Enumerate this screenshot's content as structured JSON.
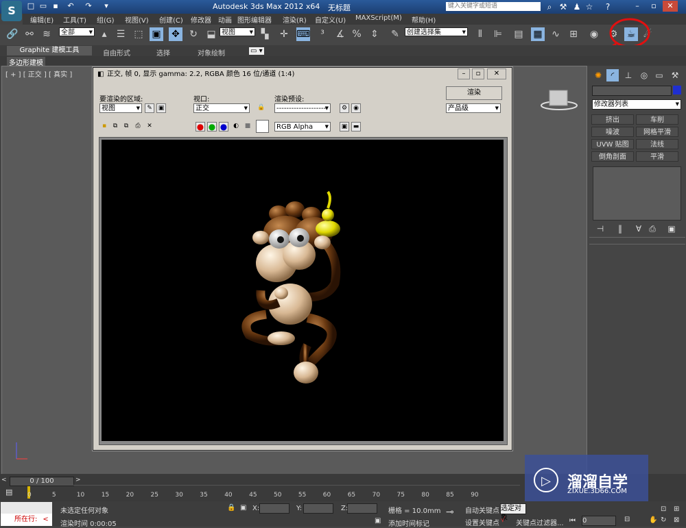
{
  "app": {
    "logo_letter": "S",
    "title": "Autodesk 3ds Max  2012 x64",
    "file_title": "无标题",
    "search_placeholder": "键入关键字或短语"
  },
  "menu": [
    "编辑(E)",
    "工具(T)",
    "组(G)",
    "视图(V)",
    "创建(C)",
    "修改器",
    "动画",
    "图形编辑器",
    "渲染(R)",
    "自定义(U)",
    "MAXScript(M)",
    "帮助(H)"
  ],
  "toolbar": {
    "selection_filter": "全部",
    "ref_coord": "视图",
    "named_selection": "创建选择集"
  },
  "ribbon": {
    "tabs": [
      "Graphite 建模工具",
      "自由形式",
      "选择",
      "对象绘制"
    ],
    "subtab": "多边形建模"
  },
  "viewport": {
    "label": "[ + ] [ 正交 ] [ 真实 ]"
  },
  "render_window": {
    "title": "正交, 帧 0, 显示 gamma: 2.2, RGBA 颜色 16 位/通道 (1:4)",
    "area_label": "要渲染的区域:",
    "area_value": "视图",
    "viewport_label": "视口:",
    "viewport_value": "正交",
    "preset_label": "渲染预设:",
    "preset_value": "--------------------",
    "render_button": "渲染",
    "quality_value": "产品级",
    "channel_value": "RGB Alpha"
  },
  "command_panel": {
    "modifier_list": "修改器列表",
    "buttons": [
      "挤出",
      "车削",
      "噪波",
      "网格平滑",
      "UVW 贴图",
      "法线",
      "倒角剖面",
      "平滑"
    ]
  },
  "timeline": {
    "slider_label": "0 / 100",
    "ticks": [
      "0",
      "5",
      "10",
      "15",
      "20",
      "25",
      "30",
      "35",
      "40",
      "45",
      "50",
      "55",
      "60",
      "65",
      "70",
      "75",
      "80",
      "85",
      "90"
    ]
  },
  "status": {
    "running_label": "所在行:",
    "selection": "未选定任何对象",
    "render_time": "渲染时间  0:00:05",
    "x_label": "X:",
    "y_label": "Y:",
    "z_label": "Z:",
    "grid": "栅格 = 10.0mm",
    "add_time_tag": "添加时间标记",
    "auto_key": "自动关键点",
    "selected_obj": "选定对象",
    "set_key": "设置关键点",
    "key_filters": "关键点过滤器...",
    "frame": "0"
  },
  "watermark": {
    "title": "溜溜自学",
    "url": "ZIXUE.3D66.COM"
  },
  "colors": {
    "accent_red": "#e01010",
    "title_blue": "#1c3f72"
  }
}
